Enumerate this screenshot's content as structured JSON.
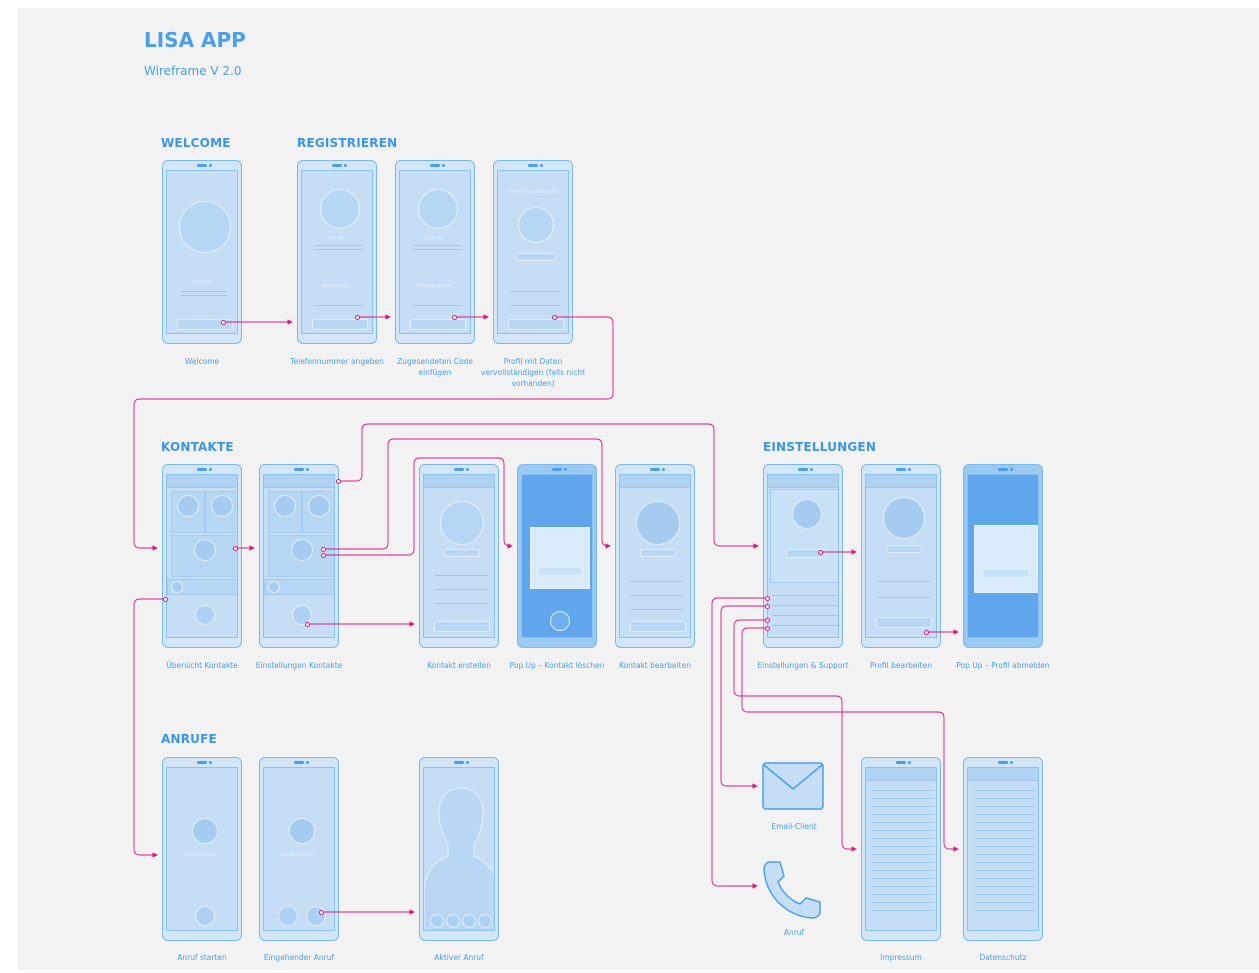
{
  "header": {
    "title": "LISA APP",
    "subtitle": "Wireframe V 2.0"
  },
  "sections": {
    "welcome": "WELCOME",
    "registrieren": "REGISTRIEREN",
    "kontakte": "KONTAKTE",
    "einstellungen": "EINSTELLUNGEN",
    "anrufe": "ANRUFE"
  },
  "screens": [
    {
      "caption": "Welcome"
    },
    {
      "caption": "Telefonnummer angeben"
    },
    {
      "caption": "Zugesendeten Code einfügen"
    },
    {
      "caption": "Profil mit Daten vervollständigen (falls nicht vorhanden)"
    },
    {
      "caption": "Übersicht Kontakte"
    },
    {
      "caption": "Einstellungen Kontakte"
    },
    {
      "caption": "Kontakt erstellen"
    },
    {
      "caption": "Pop Up – Kontakt löschen"
    },
    {
      "caption": "Kontakt bearbeiten"
    },
    {
      "caption": "Einstellungen & Support"
    },
    {
      "caption": "Profil bearbeiten"
    },
    {
      "caption": "Pop Up – Profil abmelden"
    },
    {
      "caption": "Anruf starten"
    },
    {
      "caption": "Eingehender Anruf"
    },
    {
      "caption": "Aktiver Anruf"
    },
    {
      "caption": "Impressum"
    },
    {
      "caption": "Datenschutz"
    }
  ],
  "external": {
    "email": "Email-Client",
    "call": "Anruf"
  },
  "colors": {
    "accent": "#4a9fe8",
    "connector": "#e0177f",
    "canvas": "#f2f2f2"
  }
}
